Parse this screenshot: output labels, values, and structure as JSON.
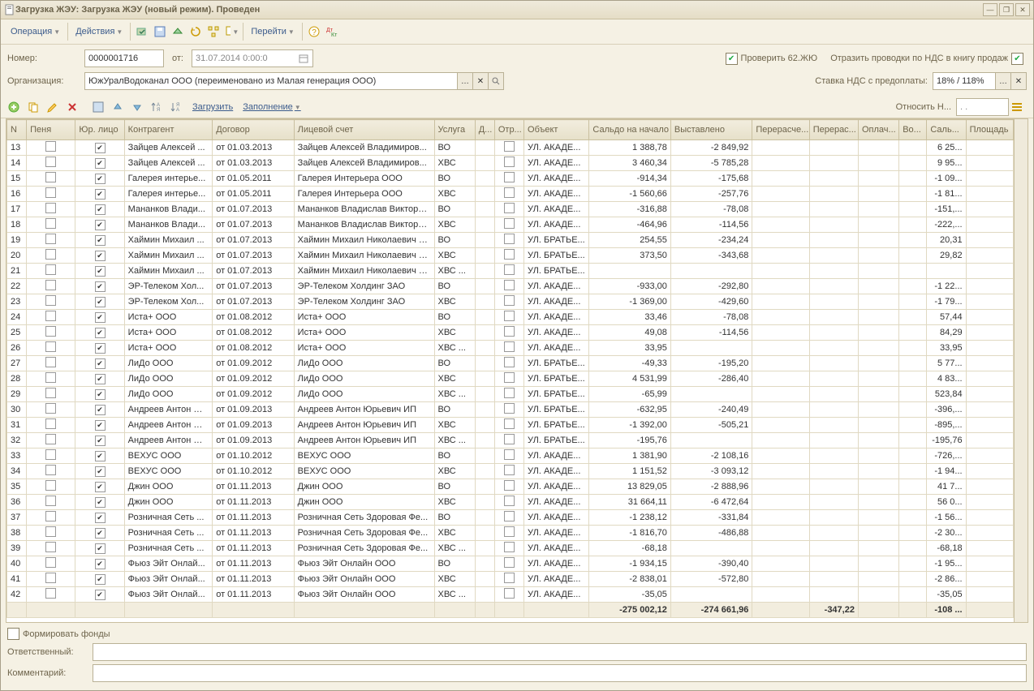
{
  "title": "Загрузка ЖЭУ: Загрузка ЖЭУ (новый режим). Проведен",
  "menu": {
    "op": "Операция",
    "act": "Действия",
    "go": "Перейти"
  },
  "number_label": "Номер:",
  "number": "0000001716",
  "ot": "от:",
  "date": "31.07.2014 0:00:0",
  "org_label": "Организация:",
  "org": "ЮжУралВодоканал ООО (переименовано из Малая генерация ООО)",
  "check62": "Проверить 62.ЖЮ",
  "nds_text": "Отразить проводки по НДС в книгу продаж",
  "vat_label": "Ставка НДС с предоплаты:",
  "vat_value": "18% / 118%",
  "tb2": {
    "load": "Загрузить",
    "fill": "Заполнение",
    "rel": "Относить Н..."
  },
  "columns": [
    "N",
    "Пеня",
    "Юр. лицо",
    "Контрагент",
    "Договор",
    "Лицевой счет",
    "Услуга",
    "Д...",
    "Отр...",
    "Объект",
    "Сальдо на начало",
    "Выставлено",
    "Перерасче...",
    "Перерас...",
    "Оплач...",
    "Во...",
    "Саль...",
    "Площадь"
  ],
  "rows": [
    {
      "n": "13",
      "k": "Зайцев Алексей ...",
      "d": "от 01.03.2013",
      "l": "Зайцев Алексей Владимиров...",
      "s": "ВО",
      "o": "УЛ. АКАДЕ...",
      "sb": "1 388,78",
      "v": "-2 849,92",
      "sal": "6 25..."
    },
    {
      "n": "14",
      "k": "Зайцев Алексей ...",
      "d": "от 01.03.2013",
      "l": "Зайцев Алексей Владимиров...",
      "s": "ХВС",
      "o": "УЛ. АКАДЕ...",
      "sb": "3 460,34",
      "v": "-5 785,28",
      "sal": "9 95..."
    },
    {
      "n": "15",
      "k": "Галерея интерье...",
      "d": "от 01.05.2011",
      "l": "Галерея Интерьера ООО",
      "s": "ВО",
      "o": "УЛ. АКАДЕ...",
      "sb": "-914,34",
      "v": "-175,68",
      "sal": "-1 09..."
    },
    {
      "n": "16",
      "k": "Галерея интерье...",
      "d": "от 01.05.2011",
      "l": "Галерея Интерьера ООО",
      "s": "ХВС",
      "o": "УЛ. АКАДЕ...",
      "sb": "-1 560,66",
      "v": "-257,76",
      "sal": "-1 81..."
    },
    {
      "n": "17",
      "k": "Мананков Влади...",
      "d": "от 01.07.2013",
      "l": "Мананков Владислав Викторо...",
      "s": "ВО",
      "o": "УЛ. АКАДЕ...",
      "sb": "-316,88",
      "v": "-78,08",
      "sal": "-151,..."
    },
    {
      "n": "18",
      "k": "Мананков Влади...",
      "d": "от 01.07.2013",
      "l": "Мананков Владислав Викторо...",
      "s": "ХВС",
      "o": "УЛ. АКАДЕ...",
      "sb": "-464,96",
      "v": "-114,56",
      "sal": "-222,..."
    },
    {
      "n": "19",
      "k": "Хаймин Михаил ...",
      "d": "от 01.07.2013",
      "l": "Хаймин Михаил Николаевич ИП",
      "s": "ВО",
      "o": "УЛ. БРАТЬЕ...",
      "sb": "254,55",
      "v": "-234,24",
      "sal": "20,31"
    },
    {
      "n": "20",
      "k": "Хаймин Михаил ...",
      "d": "от 01.07.2013",
      "l": "Хаймин Михаил Николаевич ИП",
      "s": "ХВС",
      "o": "УЛ. БРАТЬЕ...",
      "sb": "373,50",
      "v": "-343,68",
      "sal": "29,82"
    },
    {
      "n": "21",
      "k": "Хаймин Михаил ...",
      "d": "от 01.07.2013",
      "l": "Хаймин Михаил Николаевич ИП",
      "s": "ХВС ...",
      "o": "УЛ. БРАТЬЕ...",
      "sb": "",
      "v": "",
      "sal": ""
    },
    {
      "n": "22",
      "k": "ЭР-Телеком Хол...",
      "d": "от 01.07.2013",
      "l": "ЭР-Телеком Холдинг ЗАО",
      "s": "ВО",
      "o": "УЛ. АКАДЕ...",
      "sb": "-933,00",
      "v": "-292,80",
      "sal": "-1 22..."
    },
    {
      "n": "23",
      "k": "ЭР-Телеком Хол...",
      "d": "от 01.07.2013",
      "l": "ЭР-Телеком Холдинг ЗАО",
      "s": "ХВС",
      "o": "УЛ. АКАДЕ...",
      "sb": "-1 369,00",
      "v": "-429,60",
      "sal": "-1 79..."
    },
    {
      "n": "24",
      "k": "Иста+ ООО",
      "d": "от 01.08.2012",
      "l": "Иста+ ООО",
      "s": "ВО",
      "o": "УЛ. АКАДЕ...",
      "sb": "33,46",
      "v": "-78,08",
      "sal": "57,44"
    },
    {
      "n": "25",
      "k": "Иста+ ООО",
      "d": "от 01.08.2012",
      "l": "Иста+ ООО",
      "s": "ХВС",
      "o": "УЛ. АКАДЕ...",
      "sb": "49,08",
      "v": "-114,56",
      "sal": "84,29"
    },
    {
      "n": "26",
      "k": "Иста+ ООО",
      "d": "от 01.08.2012",
      "l": "Иста+ ООО",
      "s": "ХВС ...",
      "o": "УЛ. АКАДЕ...",
      "sb": "33,95",
      "v": "",
      "sal": "33,95"
    },
    {
      "n": "27",
      "k": "ЛиДо ООО",
      "d": "от 01.09.2012",
      "l": "ЛиДо ООО",
      "s": "ВО",
      "o": "УЛ. БРАТЬЕ...",
      "sb": "-49,33",
      "v": "-195,20",
      "sal": "5 77..."
    },
    {
      "n": "28",
      "k": "ЛиДо ООО",
      "d": "от 01.09.2012",
      "l": "ЛиДо ООО",
      "s": "ХВС",
      "o": "УЛ. БРАТЬЕ...",
      "sb": "4 531,99",
      "v": "-286,40",
      "sal": "4 83..."
    },
    {
      "n": "29",
      "k": "ЛиДо ООО",
      "d": "от 01.09.2012",
      "l": "ЛиДо ООО",
      "s": "ХВС ...",
      "o": "УЛ. БРАТЬЕ...",
      "sb": "-65,99",
      "v": "",
      "sal": "523,84"
    },
    {
      "n": "30",
      "k": "Андреев Антон Ю...",
      "d": "от 01.09.2013",
      "l": "Андреев Антон Юрьевич ИП",
      "s": "ВО",
      "o": "УЛ. БРАТЬЕ...",
      "sb": "-632,95",
      "v": "-240,49",
      "sal": "-396,..."
    },
    {
      "n": "31",
      "k": "Андреев Антон Ю...",
      "d": "от 01.09.2013",
      "l": "Андреев Антон Юрьевич ИП",
      "s": "ХВС",
      "o": "УЛ. БРАТЬЕ...",
      "sb": "-1 392,00",
      "v": "-505,21",
      "sal": "-895,..."
    },
    {
      "n": "32",
      "k": "Андреев Антон Ю...",
      "d": "от 01.09.2013",
      "l": "Андреев Антон Юрьевич ИП",
      "s": "ХВС ...",
      "o": "УЛ. БРАТЬЕ...",
      "sb": "-195,76",
      "v": "",
      "sal": "-195,76"
    },
    {
      "n": "33",
      "k": "ВЕХУС ООО",
      "d": "от 01.10.2012",
      "l": "ВЕХУС ООО",
      "s": "ВО",
      "o": "УЛ. АКАДЕ...",
      "sb": "1 381,90",
      "v": "-2 108,16",
      "sal": "-726,..."
    },
    {
      "n": "34",
      "k": "ВЕХУС ООО",
      "d": "от 01.10.2012",
      "l": "ВЕХУС ООО",
      "s": "ХВС",
      "o": "УЛ. АКАДЕ...",
      "sb": "1 151,52",
      "v": "-3 093,12",
      "sal": "-1 94..."
    },
    {
      "n": "35",
      "k": "Джин ООО",
      "d": "от 01.11.2013",
      "l": "Джин ООО",
      "s": "ВО",
      "o": "УЛ. АКАДЕ...",
      "sb": "13 829,05",
      "v": "-2 888,96",
      "sal": "41 7..."
    },
    {
      "n": "36",
      "k": "Джин ООО",
      "d": "от 01.11.2013",
      "l": "Джин ООО",
      "s": "ХВС",
      "o": "УЛ. АКАДЕ...",
      "sb": "31 664,11",
      "v": "-6 472,64",
      "sal": "56 0..."
    },
    {
      "n": "37",
      "k": "Розничная Сеть ...",
      "d": "от 01.11.2013",
      "l": "Розничная Сеть Здоровая Фе...",
      "s": "ВО",
      "o": "УЛ. АКАДЕ...",
      "sb": "-1 238,12",
      "v": "-331,84",
      "sal": "-1 56..."
    },
    {
      "n": "38",
      "k": "Розничная Сеть ...",
      "d": "от 01.11.2013",
      "l": "Розничная Сеть Здоровая Фе...",
      "s": "ХВС",
      "o": "УЛ. АКАДЕ...",
      "sb": "-1 816,70",
      "v": "-486,88",
      "sal": "-2 30..."
    },
    {
      "n": "39",
      "k": "Розничная Сеть ...",
      "d": "от 01.11.2013",
      "l": "Розничная Сеть Здоровая Фе...",
      "s": "ХВС ...",
      "o": "УЛ. АКАДЕ...",
      "sb": "-68,18",
      "v": "",
      "sal": "-68,18"
    },
    {
      "n": "40",
      "k": "Фьюз Эйт Онлай...",
      "d": "от 01.11.2013",
      "l": "Фьюз Эйт Онлайн ООО",
      "s": "ВО",
      "o": "УЛ. АКАДЕ...",
      "sb": "-1 934,15",
      "v": "-390,40",
      "sal": "-1 95..."
    },
    {
      "n": "41",
      "k": "Фьюз Эйт Онлай...",
      "d": "от 01.11.2013",
      "l": "Фьюз Эйт Онлайн ООО",
      "s": "ХВС",
      "o": "УЛ. АКАДЕ...",
      "sb": "-2 838,01",
      "v": "-572,80",
      "sal": "-2 86..."
    },
    {
      "n": "42",
      "k": "Фьюз Эйт Онлай...",
      "d": "от 01.11.2013",
      "l": "Фьюз Эйт Онлайн ООО",
      "s": "ХВС ...",
      "o": "УЛ. АКАДЕ...",
      "sb": "-35,05",
      "v": "",
      "sal": "-35,05"
    }
  ],
  "totals": {
    "sb": "-275 002,12",
    "v": "-274 661,96",
    "pr": "-347,22",
    "sal": "-108 ..."
  },
  "funds": "Формировать фонды",
  "resp": "Ответственный:",
  "comment": "Комментарий:"
}
